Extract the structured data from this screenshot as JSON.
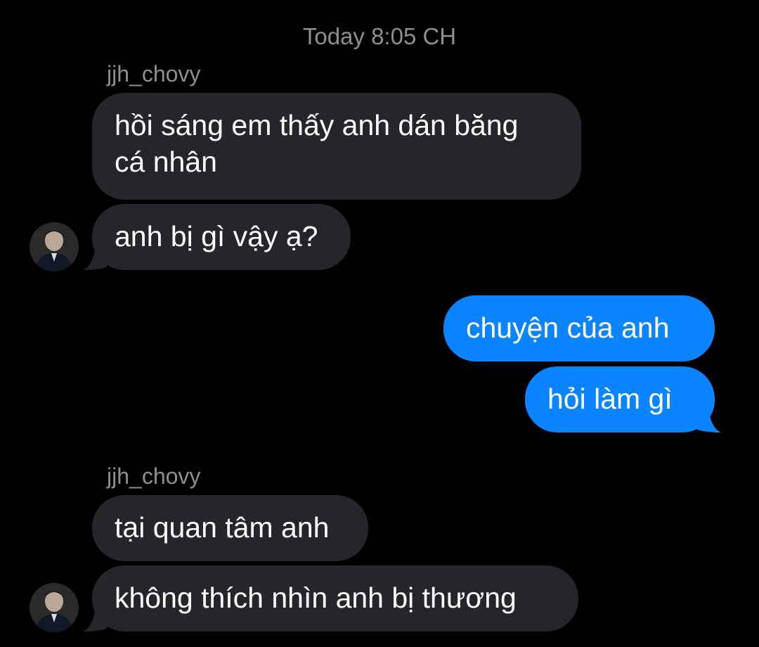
{
  "conversation": {
    "timestamp": "Today 8:05 CH",
    "groups": [
      {
        "sender": "jjh_chovy",
        "messages": [
          "hồi sáng em thấy anh dán băng\ncá nhân",
          "anh bị gì vậy ạ?"
        ]
      },
      {
        "sender": "me",
        "messages": [
          "chuyện của anh",
          "hỏi làm gì"
        ]
      },
      {
        "sender": "jjh_chovy",
        "messages": [
          "tại quan tâm anh",
          "không thích nhìn anh bị thương"
        ]
      }
    ]
  },
  "colors": {
    "background": "#000000",
    "incoming_bubble": "#26252a",
    "outgoing_bubble": "#0a84ff",
    "meta_text": "#8e8e93"
  }
}
